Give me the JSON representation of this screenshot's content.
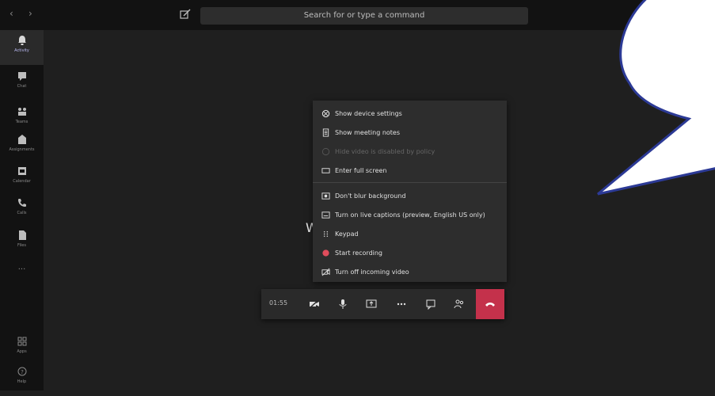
{
  "header": {
    "back_icon": "chevron-left-icon",
    "forward_icon": "chevron-right-icon",
    "compose_icon": "compose-icon",
    "search_placeholder": "Search for or type a command"
  },
  "sidebar": {
    "items": [
      {
        "label": "Activity",
        "icon": "bell-icon",
        "active": true
      },
      {
        "label": "Chat",
        "icon": "chat-icon"
      },
      {
        "label": "Teams",
        "icon": "teams-icon"
      },
      {
        "label": "Assignments",
        "icon": "assignments-icon"
      },
      {
        "label": "Calendar",
        "icon": "calendar-icon"
      },
      {
        "label": "Calls",
        "icon": "phone-icon"
      },
      {
        "label": "Files",
        "icon": "file-icon"
      }
    ],
    "more_label": "...",
    "apps_label": "Apps",
    "help_label": "Help"
  },
  "stage": {
    "status_text": "W"
  },
  "menu": {
    "items": [
      {
        "label": "Show device settings",
        "icon": "gear-icon"
      },
      {
        "label": "Show meeting notes",
        "icon": "notes-icon"
      },
      {
        "label": "Hide video is disabled by policy",
        "icon": "info-icon",
        "disabled": true
      },
      {
        "label": "Enter full screen",
        "icon": "fullscreen-icon"
      },
      {
        "label": "Don't blur background",
        "icon": "blur-icon"
      },
      {
        "label": "Turn on live captions (preview, English US only)",
        "icon": "captions-icon"
      },
      {
        "label": "Keypad",
        "icon": "keypad-icon"
      },
      {
        "label": "Start recording",
        "icon": "record-icon"
      },
      {
        "label": "Turn off incoming video",
        "icon": "video-off-icon"
      }
    ]
  },
  "callbar": {
    "timer": "01:55",
    "record_color": "#e04d5c",
    "hangup_color": "#c4314b"
  }
}
